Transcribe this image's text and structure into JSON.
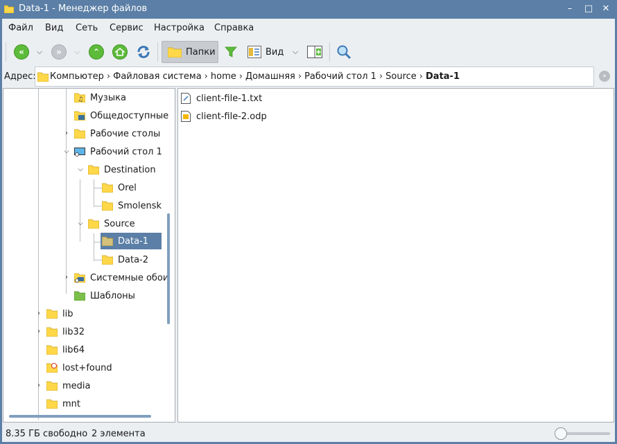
{
  "window": {
    "title": "Data-1 - Менеджер файлов",
    "minimize_glyph": "–",
    "maximize_glyph": "□",
    "close_glyph": "✕"
  },
  "menu": {
    "file": "Файл",
    "view": "Вид",
    "network": "Сеть",
    "service": "Сервис",
    "settings": "Настройка",
    "help": "Справка"
  },
  "toolbar": {
    "back_glyph": "«",
    "forward_glyph": "»",
    "up_glyph": "⌃",
    "folders_label": "Папки",
    "view_label": "Вид"
  },
  "address": {
    "label": "Адрес:",
    "crumbs": [
      "Компьютер",
      "Файловая система",
      "home",
      "Домашняя",
      "Рабочий стол 1",
      "Source"
    ],
    "current": "Data-1",
    "sep": "›"
  },
  "tree": {
    "items": [
      {
        "label": "Музыка",
        "icon": "music-folder-icon"
      },
      {
        "label": "Общедоступные",
        "icon": "public-folder-icon"
      },
      {
        "label": "Рабочие столы",
        "icon": "folder-icon"
      },
      {
        "label": "Рабочий стол 1",
        "icon": "desktop-icon"
      },
      {
        "label": "Destination",
        "icon": "folder-icon"
      },
      {
        "label": "Orel",
        "icon": "folder-icon"
      },
      {
        "label": "Smolensk",
        "icon": "folder-icon"
      },
      {
        "label": "Source",
        "icon": "folder-icon"
      },
      {
        "label": "Data-1",
        "icon": "folder-icon"
      },
      {
        "label": "Data-2",
        "icon": "folder-icon"
      },
      {
        "label": "Системные обои",
        "icon": "wallpaper-folder-icon"
      },
      {
        "label": "Шаблоны",
        "icon": "templates-folder-icon"
      },
      {
        "label": "lib",
        "icon": "folder-icon"
      },
      {
        "label": "lib32",
        "icon": "folder-icon"
      },
      {
        "label": "lib64",
        "icon": "folder-icon"
      },
      {
        "label": "lost+found",
        "icon": "lost-found-folder-icon"
      },
      {
        "label": "media",
        "icon": "folder-icon"
      },
      {
        "label": "mnt",
        "icon": "folder-icon"
      }
    ],
    "selected": "Data-1"
  },
  "files": [
    {
      "name": "client-file-1.txt",
      "icon": "text-file-icon"
    },
    {
      "name": "client-file-2.odp",
      "icon": "presentation-file-icon"
    }
  ],
  "status": {
    "free_space": "8.35 ГБ свободно",
    "count": "2 элемента"
  },
  "colors": {
    "accent": "#5b7fa6",
    "folder": "#ffd84a",
    "nav_green": "#5dbb3a"
  }
}
